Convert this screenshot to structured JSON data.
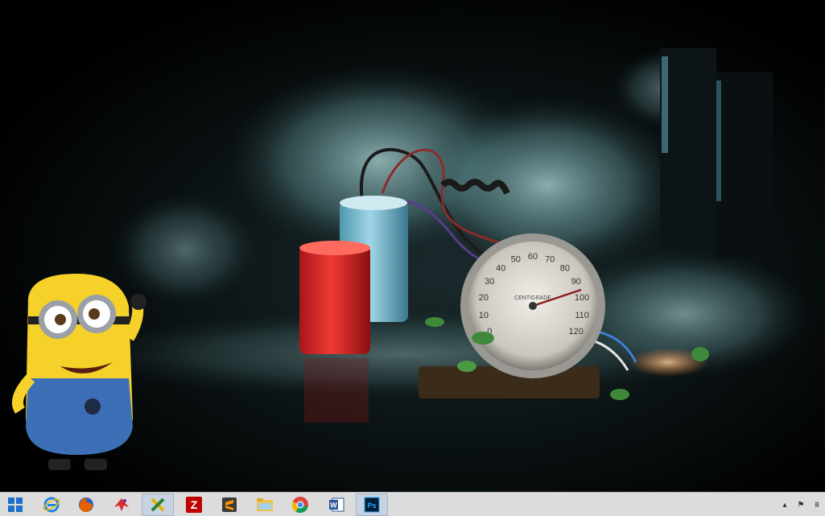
{
  "desktop": {
    "wallpaper": {
      "description": "",
      "gauge_label": "CENTIGRADE",
      "gauge_ticks": [
        "0",
        "10",
        "20",
        "30",
        "40",
        "50",
        "60",
        "70",
        "80",
        "90",
        "100",
        "110",
        "120"
      ]
    }
  },
  "taskbar": {
    "start_icon": "windows-logo-icon",
    "pinned": [
      {
        "name": "internet-explorer-icon",
        "color": "#1e88e5"
      },
      {
        "name": "firefox-icon",
        "color": "#e66000"
      },
      {
        "name": "app-red-bird-icon",
        "color": "#d32f2f"
      },
      {
        "name": "tools-crossed-icon",
        "color": "#e0b400"
      },
      {
        "name": "filezilla-icon",
        "color": "#bf0000"
      },
      {
        "name": "sublime-text-icon",
        "color": "#ff9800"
      },
      {
        "name": "file-explorer-icon",
        "color": "#f2c14e"
      },
      {
        "name": "chrome-icon",
        "color": "#4caf50"
      },
      {
        "name": "word-icon",
        "color": "#2b579a"
      },
      {
        "name": "photoshop-icon",
        "color": "#001e36"
      }
    ],
    "tray": {
      "chevron_icon": "show-hidden-icons-chevron",
      "flag_icon": "action-center-flag-icon",
      "network_icon": "network-icon"
    }
  }
}
